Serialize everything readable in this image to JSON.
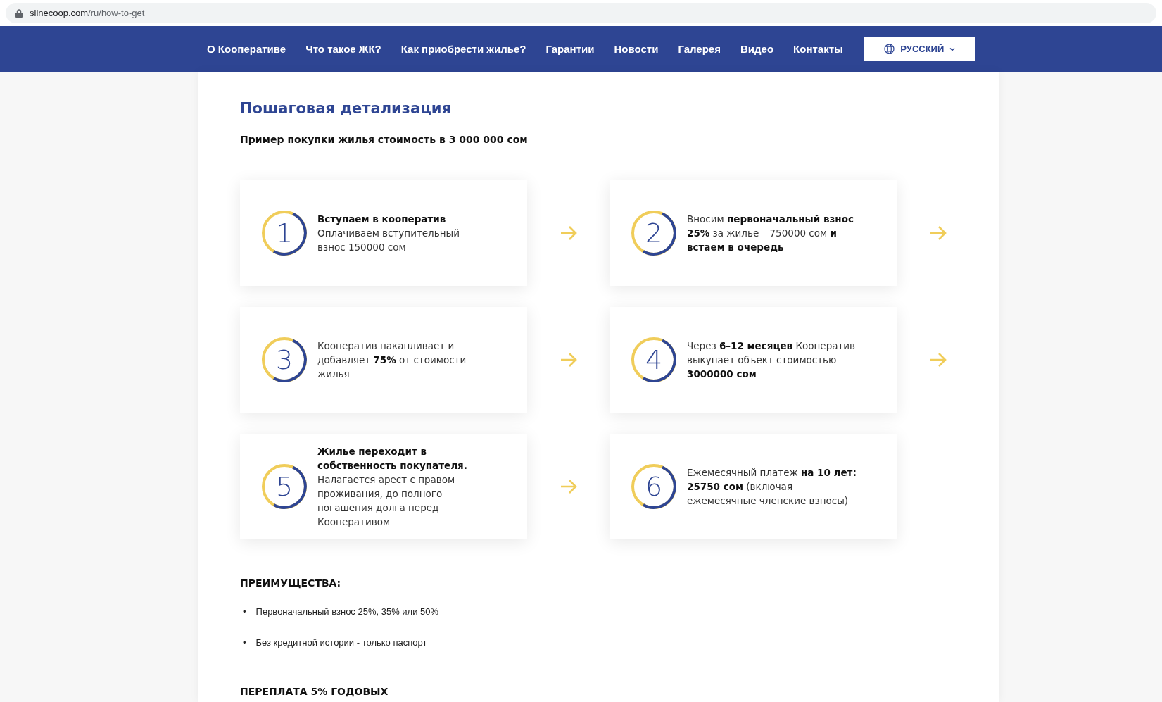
{
  "address_bar": {
    "domain": "slinecoop.com",
    "path": "/ru/how-to-get"
  },
  "nav": {
    "items": [
      "О Кооперативе",
      "Что такое ЖК?",
      "Как приобрести жилье?",
      "Гарантии",
      "Новости",
      "Галерея",
      "Видео",
      "Контакты"
    ],
    "language": "РУССКИЙ"
  },
  "heading": "Пошаговая детализация",
  "subtitle": "Пример покупки жилья стоимость в 3 000 000 сом",
  "steps": [
    {
      "number": "1",
      "title": "Вступаем в кооператив",
      "text": "Оплачиваем вступительный взнос 150000 сом",
      "arrow": true
    },
    {
      "number": "2",
      "text": "Вносим **первоначальный взнос 25%** за жилье – 750000 сом **и встаем в очередь**",
      "arrow": true
    },
    {
      "number": "3",
      "text": "Кооператив накапливает и добавляет **75%** от стоимости жилья",
      "arrow": true
    },
    {
      "number": "4",
      "text": "Через **6–12 месяцев** Кооператив выкупает объект стоимостью **3000000 сом**",
      "arrow": true
    },
    {
      "number": "5",
      "title": "Жилье переходит в собственность покупателя.",
      "text": "Налагается арест с правом проживания, до полного погашения долга перед Кооперативом",
      "arrow": true
    },
    {
      "number": "6",
      "text": "Ежемесячный платеж **на 10 лет: 25750 сом** (включая  ежемесячные членские взносы)",
      "arrow": false
    }
  ],
  "advantages": {
    "heading": "ПРЕИМУЩЕСТВА:",
    "items": [
      {
        "bullet": "•",
        "text": "Первоначальный взнос 25%, 35% или 50%"
      },
      {
        "bullet": "•",
        "text": "Без кредитной истории - только паспорт"
      }
    ]
  },
  "overpay_heading": "ПЕРЕПЛАТА 5% ГОДОВЫХ"
}
